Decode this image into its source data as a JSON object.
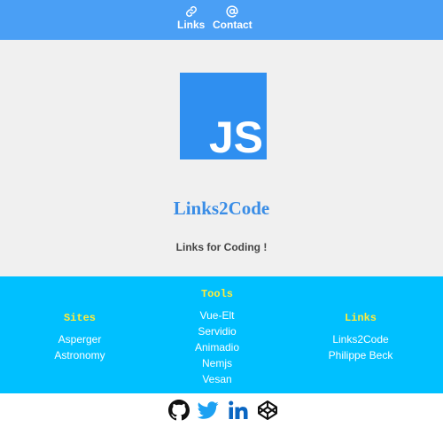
{
  "nav": {
    "items": [
      {
        "label": "Links",
        "icon": "link-icon"
      },
      {
        "label": "Contact",
        "icon": "at-icon"
      }
    ]
  },
  "hero": {
    "logo_text": "JS",
    "logo_icon": "javascript-logo",
    "title": "Links2Code",
    "tagline": "Links for Coding !"
  },
  "footer_links": {
    "sites": {
      "heading": "Sites",
      "items": [
        "Asperger",
        "Astronomy"
      ]
    },
    "tools": {
      "heading": "Tools",
      "items": [
        "Vue-Elt",
        "Servidio",
        "Animadio",
        "Nemjs",
        "Vesan"
      ]
    },
    "links": {
      "heading": "Links",
      "items": [
        "Links2Code",
        "Philippe Beck"
      ]
    }
  },
  "social": {
    "icons": [
      "github-icon",
      "twitter-icon",
      "linkedin-icon",
      "codepen-icon"
    ]
  },
  "colors": {
    "nav_bg": "#4a9ff5",
    "hero_bg": "#f0f0f0",
    "title": "#3a8de6",
    "band_bg": "#00c0ff",
    "heading": "#ffeb3b",
    "js_logo": "#2f8ff0"
  }
}
